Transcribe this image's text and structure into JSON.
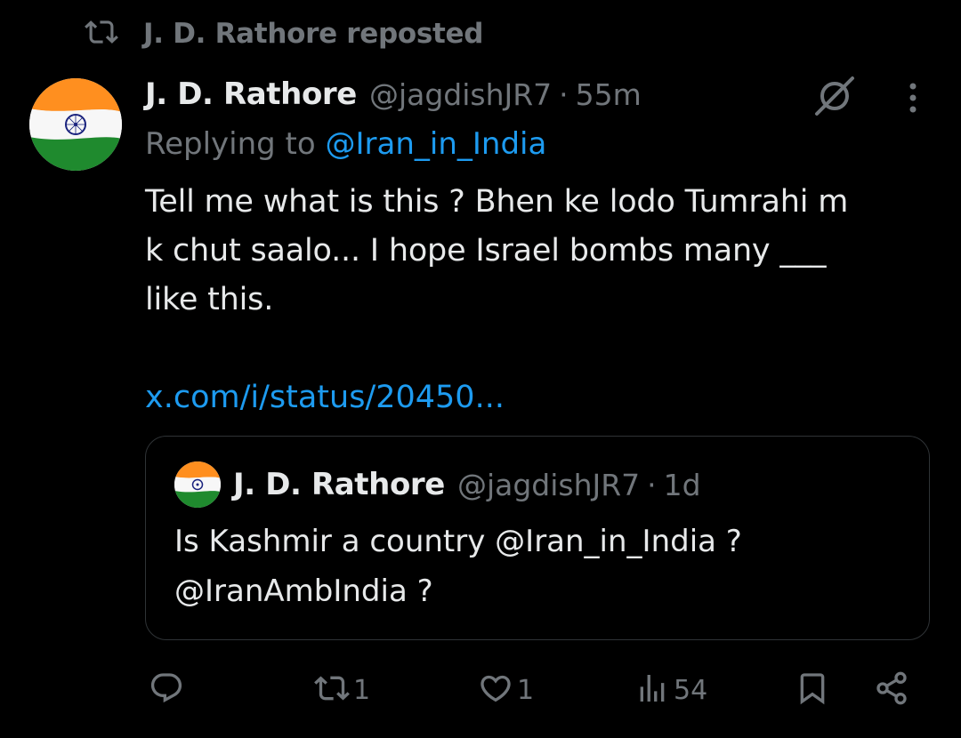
{
  "repost": {
    "label": "J. D. Rathore reposted"
  },
  "tweet": {
    "name": "J. D. Rathore",
    "handle": "@jagdishJR7",
    "separator": "·",
    "time": "55m",
    "replying_prefix": "Replying to ",
    "replying_to": "@Iran_in_India",
    "text": "Tell me what is this ? Bhen ke lodo Tumrahi m\nk chut saalo... I hope Israel bombs many ___\nlike this.",
    "link": "x.com/i/status/20450..."
  },
  "quote": {
    "name": "J. D. Rathore",
    "handle": "@jagdishJR7",
    "separator": "·",
    "time": "1d",
    "text": "Is Kashmir a country @Iran_in_India ?\n@IranAmbIndia ?"
  },
  "actions": {
    "reply_count": "",
    "repost_count": "1",
    "like_count": "1",
    "views_count": "54"
  },
  "icons": {
    "repost": "repost-icon",
    "grok": "grok-icon",
    "more": "more-vertical-icon",
    "reply": "reply-icon",
    "like": "heart-icon",
    "views": "views-icon",
    "bookmark": "bookmark-icon",
    "share": "share-icon"
  },
  "colors": {
    "background": "#000000",
    "text": "#e7e9ea",
    "muted": "#71767b",
    "link": "#1d9bf0",
    "border": "#2f3336"
  }
}
